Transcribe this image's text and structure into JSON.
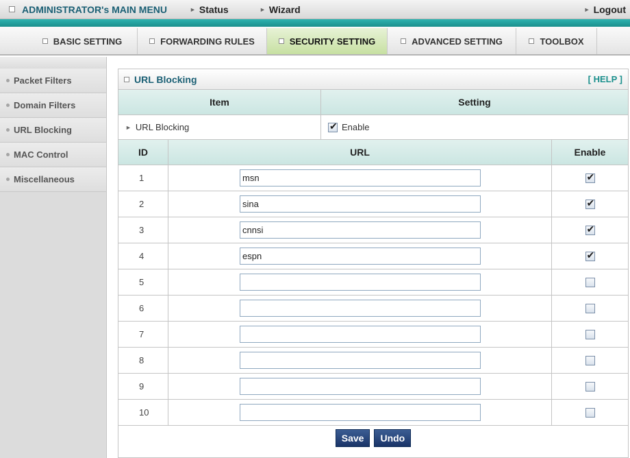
{
  "topbar": {
    "admin_menu": "ADMINISTRATOR's MAIN MENU",
    "status": "Status",
    "wizard": "Wizard",
    "logout": "Logout"
  },
  "tabs": [
    {
      "label": "BASIC SETTING",
      "active": false
    },
    {
      "label": "FORWARDING RULES",
      "active": false
    },
    {
      "label": "SECURITY SETTING",
      "active": true
    },
    {
      "label": "ADVANCED SETTING",
      "active": false
    },
    {
      "label": "TOOLBOX",
      "active": false
    }
  ],
  "sidebar": {
    "items": [
      {
        "label": "Packet Filters"
      },
      {
        "label": "Domain Filters"
      },
      {
        "label": "URL Blocking"
      },
      {
        "label": "MAC Control"
      },
      {
        "label": "Miscellaneous"
      }
    ]
  },
  "panel": {
    "title": "URL Blocking",
    "help": "[ HELP ]",
    "header": {
      "item": "Item",
      "setting": "Setting"
    },
    "url_blocking": {
      "label": "URL Blocking",
      "enable_label": "Enable",
      "enabled": true
    },
    "columns": {
      "id": "ID",
      "url": "URL",
      "enable": "Enable"
    },
    "rows": [
      {
        "id": "1",
        "url": "msn",
        "enabled": true
      },
      {
        "id": "2",
        "url": "sina",
        "enabled": true
      },
      {
        "id": "3",
        "url": "cnnsi",
        "enabled": true
      },
      {
        "id": "4",
        "url": "espn",
        "enabled": true
      },
      {
        "id": "5",
        "url": "",
        "enabled": false
      },
      {
        "id": "6",
        "url": "",
        "enabled": false
      },
      {
        "id": "7",
        "url": "",
        "enabled": false
      },
      {
        "id": "8",
        "url": "",
        "enabled": false
      },
      {
        "id": "9",
        "url": "",
        "enabled": false
      },
      {
        "id": "10",
        "url": "",
        "enabled": false
      }
    ],
    "save_label": "Save",
    "undo_label": "Undo"
  },
  "colors": {
    "teal": "#1a8f8c",
    "title_blue": "#1a5f74",
    "active_tab": "#c7e0a2",
    "button": "#1a3468"
  }
}
